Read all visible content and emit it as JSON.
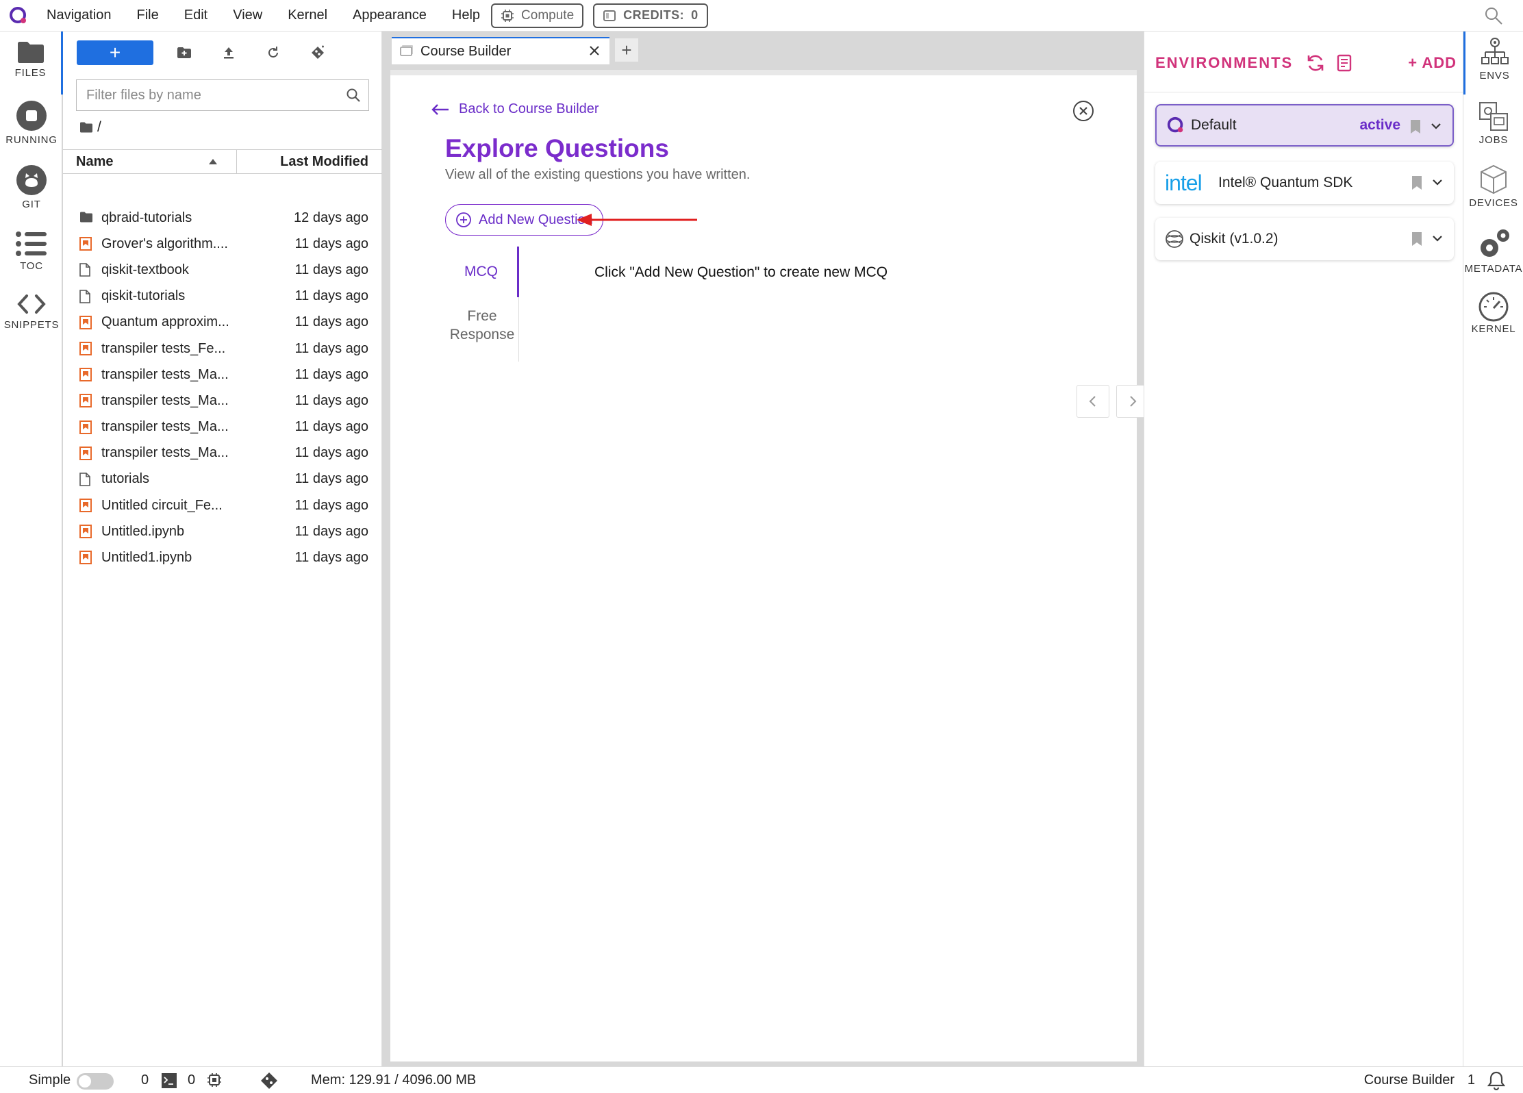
{
  "menu": {
    "items": [
      "Navigation",
      "File",
      "Edit",
      "View",
      "Kernel",
      "Appearance",
      "Help"
    ],
    "compute_label": "Compute",
    "credits_label": "CREDITS:",
    "credits_value": "0"
  },
  "left_strip": {
    "files": "FILES",
    "running": "RUNNING",
    "git": "GIT",
    "toc": "TOC",
    "snippets": "SNIPPETS"
  },
  "file_browser": {
    "new_label": "+",
    "filter_placeholder": "Filter files by name",
    "breadcrumb": "/",
    "col_name": "Name",
    "col_modified": "Last Modified",
    "files": [
      {
        "name": "qbraid-tutorials",
        "modified": "12 days ago",
        "type": "folder"
      },
      {
        "name": "Grover's algorithm....",
        "modified": "11 days ago",
        "type": "notebook"
      },
      {
        "name": "qiskit-textbook",
        "modified": "11 days ago",
        "type": "file"
      },
      {
        "name": "qiskit-tutorials",
        "modified": "11 days ago",
        "type": "file"
      },
      {
        "name": "Quantum approxim...",
        "modified": "11 days ago",
        "type": "notebook"
      },
      {
        "name": "transpiler tests_Fe...",
        "modified": "11 days ago",
        "type": "notebook"
      },
      {
        "name": "transpiler tests_Ma...",
        "modified": "11 days ago",
        "type": "notebook"
      },
      {
        "name": "transpiler tests_Ma...",
        "modified": "11 days ago",
        "type": "notebook"
      },
      {
        "name": "transpiler tests_Ma...",
        "modified": "11 days ago",
        "type": "notebook"
      },
      {
        "name": "transpiler tests_Ma...",
        "modified": "11 days ago",
        "type": "notebook"
      },
      {
        "name": "tutorials",
        "modified": "11 days ago",
        "type": "file"
      },
      {
        "name": "Untitled circuit_Fe...",
        "modified": "11 days ago",
        "type": "notebook"
      },
      {
        "name": "Untitled.ipynb",
        "modified": "11 days ago",
        "type": "notebook"
      },
      {
        "name": "Untitled1.ipynb",
        "modified": "11 days ago",
        "type": "notebook"
      }
    ]
  },
  "tabs": {
    "active_label": "Course Builder",
    "add_label": "+"
  },
  "course": {
    "back_label": "Back to Course Builder",
    "title": "Explore Questions",
    "subtitle": "View all of the existing questions you have written.",
    "add_question_label": "Add New Question",
    "tab_mcq": "MCQ",
    "tab_free_line1": "Free",
    "tab_free_line2": "Response",
    "hint": "Click \"Add New Question\" to create new MCQ"
  },
  "environments": {
    "title": "ENVIRONMENTS",
    "add_label": "+ ADD",
    "items": [
      {
        "name": "Default",
        "status": "active"
      },
      {
        "name": "Intel® Quantum SDK",
        "brand": "intel",
        "status": ""
      },
      {
        "name": "Qiskit (v1.0.2)",
        "status": ""
      }
    ]
  },
  "right_strip": {
    "envs": "ENVS",
    "jobs": "JOBS",
    "devices": "DEVICES",
    "metadata": "METADATA",
    "kernel": "KERNEL"
  },
  "status_bar": {
    "mode_label": "Simple",
    "kernels": "0",
    "terminals": "0",
    "memory": "Mem: 129.91 / 4096.00 MB",
    "document": "Course Builder",
    "count": "1"
  },
  "colors": {
    "accent_blue": "#1f6fe0",
    "purple": "#7b2ccc",
    "pink": "#d1337b",
    "notebook_orange": "#e8692a",
    "arrow_red": "#e02020"
  }
}
